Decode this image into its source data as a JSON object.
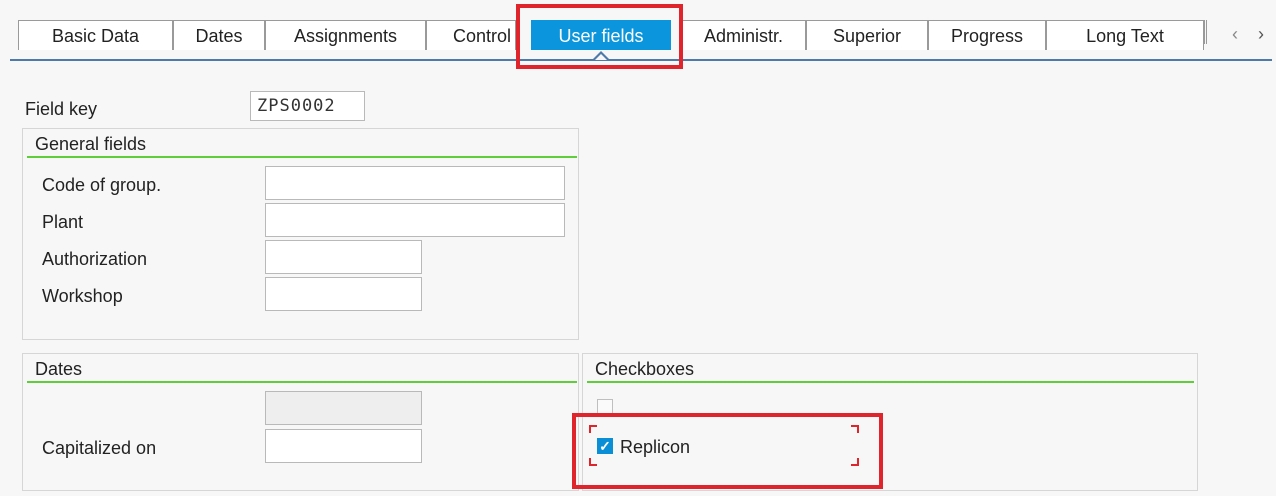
{
  "tabs": [
    {
      "label": "Basic Data"
    },
    {
      "label": "Dates"
    },
    {
      "label": "Assignments"
    },
    {
      "label": "Control"
    },
    {
      "label": "User fields"
    },
    {
      "label": "Administr."
    },
    {
      "label": "Superior"
    },
    {
      "label": "Progress"
    },
    {
      "label": "Long Text"
    }
  ],
  "field_key": {
    "label": "Field key",
    "value": "ZPS0002"
  },
  "general_fields": {
    "title": "General fields",
    "code_of_group": {
      "label": "Code of group.",
      "value": ""
    },
    "plant": {
      "label": "Plant",
      "value": ""
    },
    "authorization": {
      "label": "Authorization",
      "value": ""
    },
    "workshop": {
      "label": "Workshop",
      "value": ""
    }
  },
  "dates": {
    "title": "Dates",
    "readonly_value": "",
    "capitalized_on": {
      "label": "Capitalized on",
      "value": ""
    }
  },
  "checkboxes": {
    "title": "Checkboxes",
    "replicon": {
      "label": "Replicon",
      "checked": true
    }
  },
  "colors": {
    "active_tab": "#0a95dd",
    "highlight": "#e0242c",
    "group_underline": "#5fce3a"
  }
}
